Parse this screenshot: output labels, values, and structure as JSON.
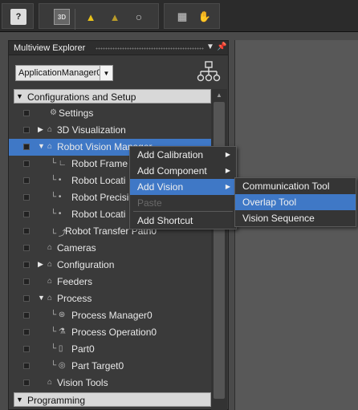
{
  "toolbar": {
    "buttons": [
      {
        "name": "help-icon",
        "glyph": "?"
      },
      {
        "name": "3d-view-icon",
        "glyph": "3D"
      },
      {
        "name": "warning-icon",
        "glyph": "▲"
      },
      {
        "name": "clear-warning-icon",
        "glyph": "▲"
      },
      {
        "name": "refresh-icon",
        "glyph": "○"
      },
      {
        "name": "calculator-icon",
        "glyph": "▦"
      },
      {
        "name": "hand-icon",
        "glyph": "✋"
      }
    ]
  },
  "explorer": {
    "title": "Multiview Explorer",
    "app_selector": "ApplicationManager0",
    "rows": [
      {
        "label": "Configurations and Setup"
      },
      {
        "label": "Settings"
      },
      {
        "label": "3D Visualization"
      },
      {
        "label": "Robot Vision Manager"
      },
      {
        "label": "Robot Frame"
      },
      {
        "label": "Robot Locati"
      },
      {
        "label": "Robot Precisi"
      },
      {
        "label": "Robot Locati"
      },
      {
        "label": "Robot Transfer Path0"
      },
      {
        "label": "Cameras"
      },
      {
        "label": "Configuration"
      },
      {
        "label": "Feeders"
      },
      {
        "label": "Process"
      },
      {
        "label": "Process Manager0"
      },
      {
        "label": "Process Operation0"
      },
      {
        "label": "Part0"
      },
      {
        "label": "Part Target0"
      },
      {
        "label": "Vision Tools"
      },
      {
        "label": "Programming"
      }
    ]
  },
  "context_menu": {
    "items": [
      {
        "label": "Add Calibration"
      },
      {
        "label": "Add Component"
      },
      {
        "label": "Add Vision"
      },
      {
        "label": "Paste"
      },
      {
        "label": "Add Shortcut"
      }
    ]
  },
  "submenu": {
    "items": [
      {
        "label": "Communication Tool"
      },
      {
        "label": "Overlap Tool"
      },
      {
        "label": "Vision Sequence"
      }
    ]
  },
  "colors": {
    "selection": "#3f78c6",
    "panel_bg": "#3a3a3a",
    "section_bg": "#d8d8d8",
    "warning_yellow": "#e8c21a"
  }
}
